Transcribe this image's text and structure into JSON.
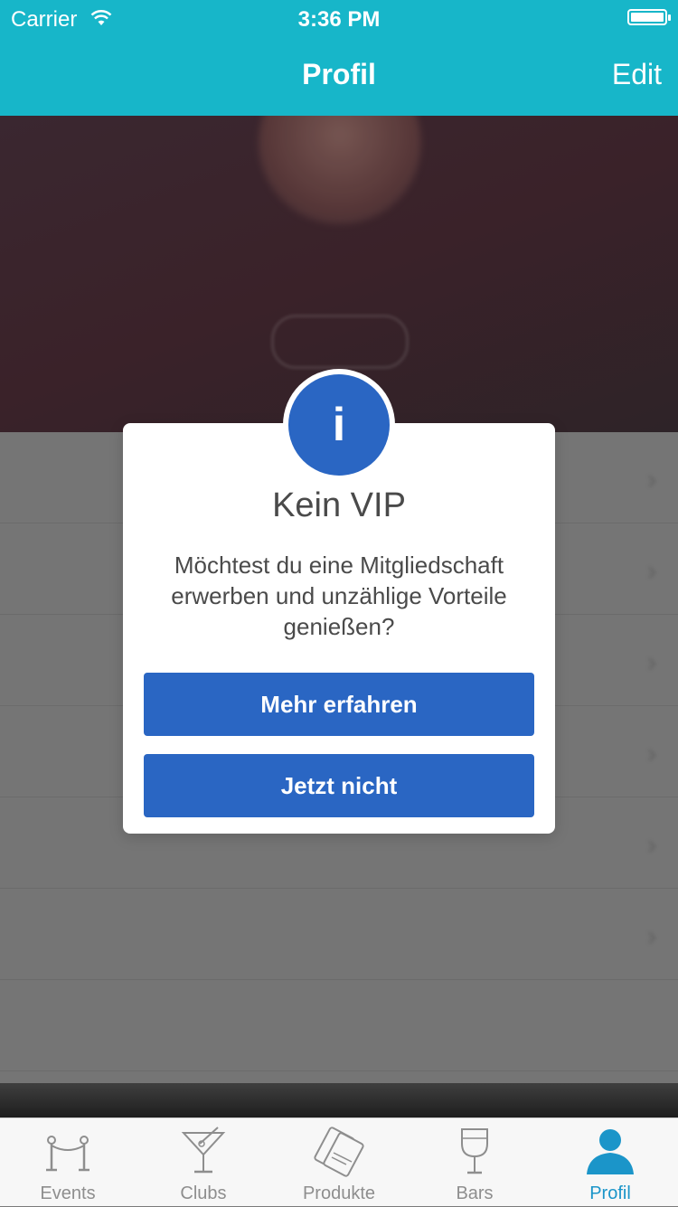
{
  "status": {
    "carrier": "Carrier",
    "time": "3:36 PM",
    "icons": [
      "wifi-icon",
      "battery-icon"
    ]
  },
  "nav": {
    "title": "Profil",
    "edit_label": "Edit"
  },
  "modal": {
    "icon": "info-icon",
    "icon_glyph": "i",
    "title": "Kein VIP",
    "line1": "Möchtest du eine Mitgliedschaft",
    "line2": "erwerben und unzählige Vorteile",
    "line3": "genießen?",
    "primary_button": "Mehr erfahren",
    "secondary_button": "Jetzt nicht"
  },
  "tabs": [
    {
      "label": "Events",
      "icon": "rope-barrier-icon",
      "active": false
    },
    {
      "label": "Clubs",
      "icon": "cocktail-glass-icon",
      "active": false
    },
    {
      "label": "Produkte",
      "icon": "tickets-icon",
      "active": false
    },
    {
      "label": "Bars",
      "icon": "wine-glass-icon",
      "active": false
    },
    {
      "label": "Profil",
      "icon": "person-icon",
      "active": true
    }
  ],
  "colors": {
    "nav_bar": "#17b6c9",
    "button": "#2a66c3",
    "tab_active": "#1b95c9",
    "tab_inactive": "#8e8e8e"
  }
}
